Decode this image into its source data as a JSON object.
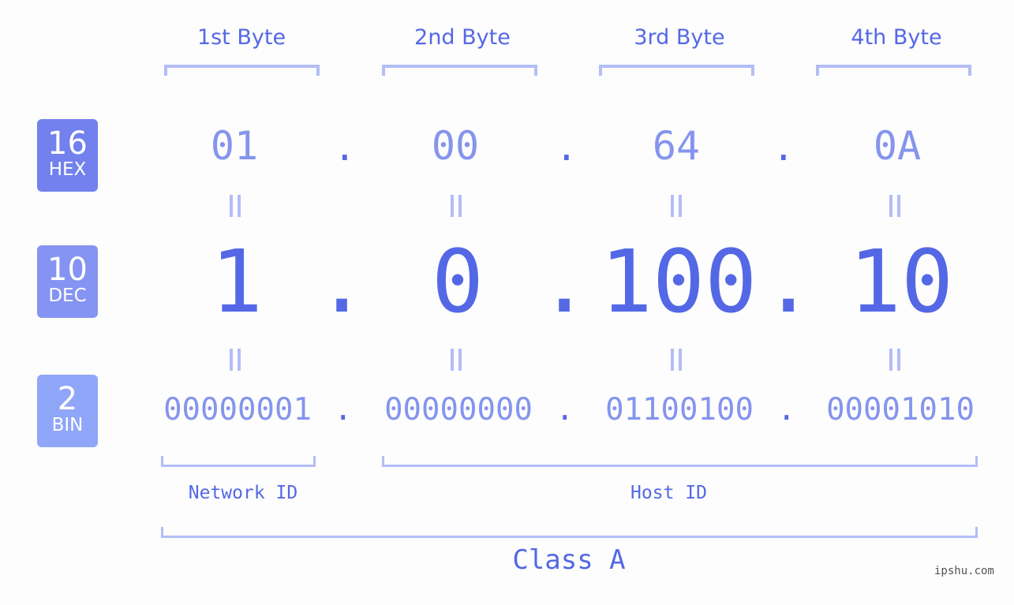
{
  "bytes": {
    "labels": [
      "1st Byte",
      "2nd Byte",
      "3rd Byte",
      "4th Byte"
    ]
  },
  "badges": {
    "hex": {
      "number": "16",
      "label": "HEX",
      "color": "#7281ed"
    },
    "dec": {
      "number": "10",
      "label": "DEC",
      "color": "#8594f2"
    },
    "bin": {
      "number": "2",
      "label": "BIN",
      "color": "#90a6f8"
    }
  },
  "ip": {
    "hex": [
      "01",
      "00",
      "64",
      "0A"
    ],
    "dec": [
      "1",
      "0",
      "100",
      "10"
    ],
    "bin": [
      "00000001",
      "00000000",
      "01100100",
      "00001010"
    ],
    "separator": "."
  },
  "parts": {
    "network_label": "Network ID",
    "host_label": "Host ID",
    "class_label": "Class A"
  },
  "colors": {
    "primary": "#5468e6",
    "secondary": "#8594ee",
    "bracket": "#b3bdf7",
    "background": "#fcfdfc"
  },
  "watermark": "ipshu.com"
}
